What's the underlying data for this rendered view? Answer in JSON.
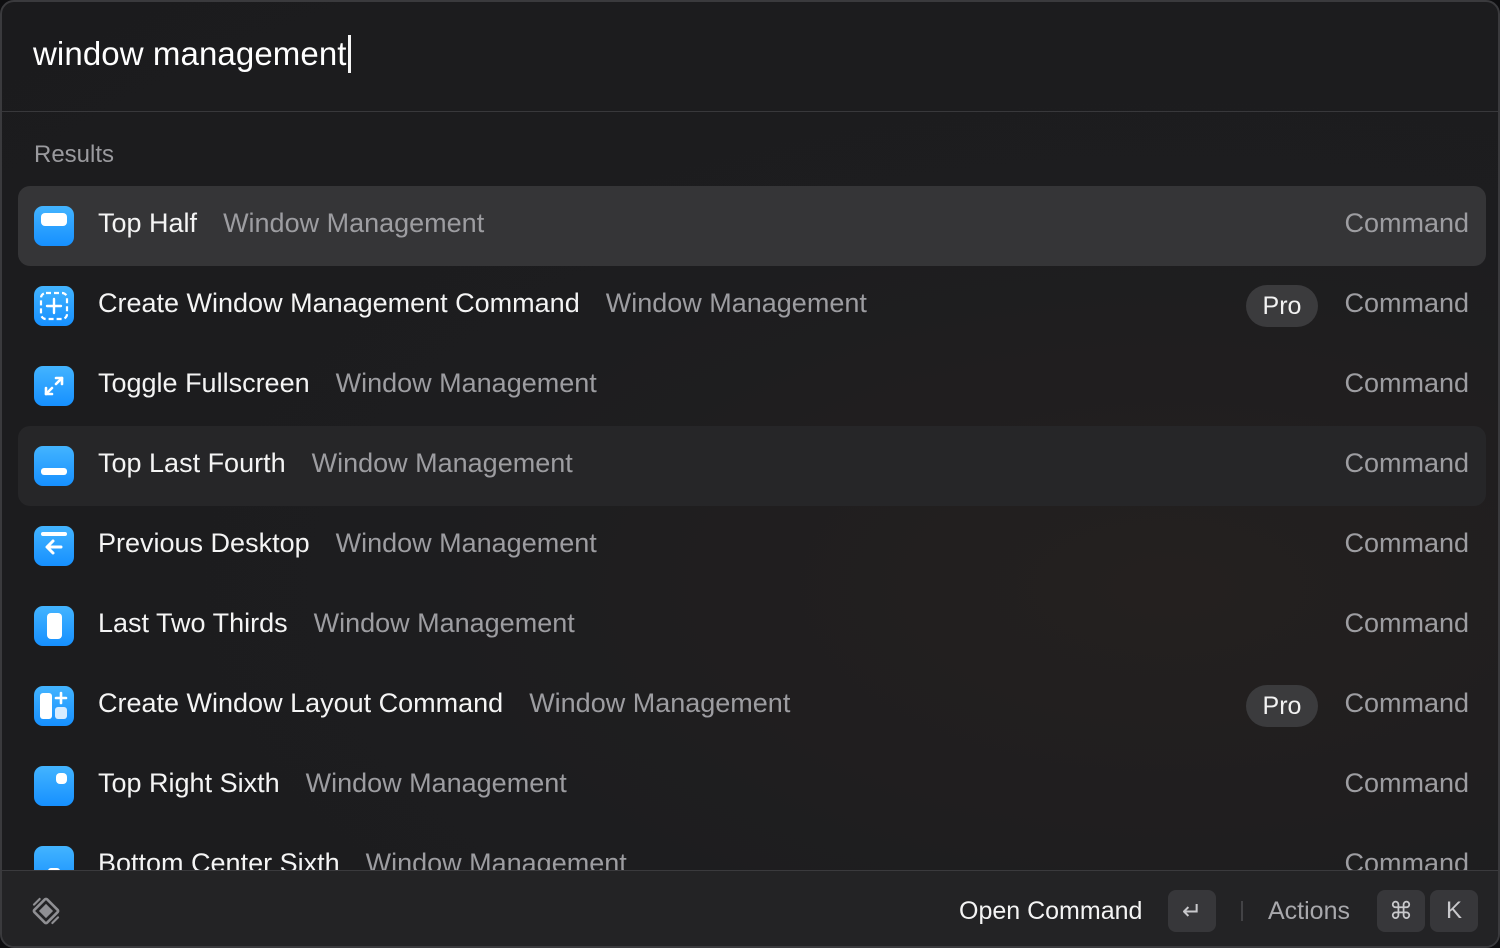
{
  "search": {
    "query": "window management"
  },
  "section_label": "Results",
  "results": [
    {
      "title": "Top Half",
      "subtitle": "Window Management",
      "type": "Command",
      "badge": "",
      "icon": "top-half-icon",
      "state": "selected"
    },
    {
      "title": "Create Window Management Command",
      "subtitle": "Window Management",
      "type": "Command",
      "badge": "Pro",
      "icon": "create-command-icon",
      "state": ""
    },
    {
      "title": "Toggle Fullscreen",
      "subtitle": "Window Management",
      "type": "Command",
      "badge": "",
      "icon": "fullscreen-icon",
      "state": ""
    },
    {
      "title": "Top Last Fourth",
      "subtitle": "Window Management",
      "type": "Command",
      "badge": "",
      "icon": "top-last-fourth-icon",
      "state": "hovered"
    },
    {
      "title": "Previous Desktop",
      "subtitle": "Window Management",
      "type": "Command",
      "badge": "",
      "icon": "previous-desktop-icon",
      "state": ""
    },
    {
      "title": "Last Two Thirds",
      "subtitle": "Window Management",
      "type": "Command",
      "badge": "",
      "icon": "last-two-thirds-icon",
      "state": ""
    },
    {
      "title": "Create Window Layout Command",
      "subtitle": "Window Management",
      "type": "Command",
      "badge": "Pro",
      "icon": "create-layout-icon",
      "state": ""
    },
    {
      "title": "Top Right Sixth",
      "subtitle": "Window Management",
      "type": "Command",
      "badge": "",
      "icon": "top-right-sixth-icon",
      "state": ""
    },
    {
      "title": "Bottom Center Sixth",
      "subtitle": "Window Management",
      "type": "Command",
      "badge": "",
      "icon": "bottom-center-sixth-icon",
      "state": ""
    }
  ],
  "footer": {
    "logo_icon": "raycast-logo-icon",
    "primary_action": "Open Command",
    "primary_key": "↵",
    "actions_label": "Actions",
    "actions_keys": [
      "⌘",
      "K"
    ]
  },
  "colors": {
    "accent_icon": "#1a92ff",
    "selected_row": "#353537",
    "background": "#1c1c1e"
  }
}
